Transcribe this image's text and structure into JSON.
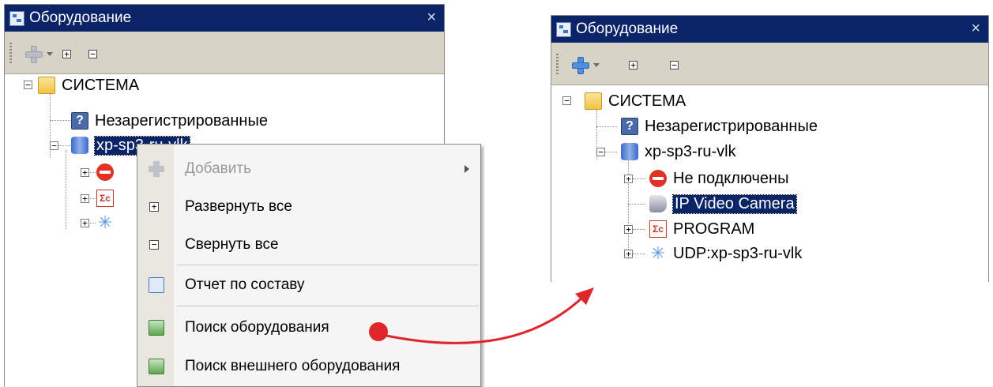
{
  "left_panel": {
    "title": "Оборудование",
    "close_glyph": "×",
    "toolbar": {
      "expand_glyph": "+",
      "collapse_glyph": "−"
    },
    "tree": [
      {
        "label": "СИСТЕМА",
        "icon": "folder-icon"
      },
      {
        "label": "Незарегистрированные",
        "icon": "question-icon"
      },
      {
        "label": "xp-sp3-ru-vlk",
        "icon": "database-icon",
        "selected": true
      }
    ]
  },
  "context_menu": {
    "items": [
      {
        "label": "Добавить",
        "icon": "plus-icon",
        "disabled": true,
        "submenu": true
      },
      {
        "label": "Развернуть все",
        "icon": "expand-box-icon"
      },
      {
        "label": "Свернуть все",
        "icon": "collapse-box-icon"
      },
      {
        "label": "Отчет по составу",
        "icon": "report-icon"
      },
      {
        "label": "Поиск оборудования",
        "icon": "search-hardware-icon"
      },
      {
        "label": "Поиск внешнего оборудования",
        "icon": "search-external-icon"
      }
    ]
  },
  "right_panel": {
    "title": "Оборудование",
    "close_glyph": "×",
    "tree": [
      {
        "label": "СИСТЕМА",
        "icon": "folder-icon"
      },
      {
        "label": "Незарегистрированные",
        "icon": "question-icon"
      },
      {
        "label": "xp-sp3-ru-vlk",
        "icon": "database-icon"
      },
      {
        "label": "Не подключены",
        "icon": "stop-icon"
      },
      {
        "label": "IP Video Camera",
        "icon": "camera-icon",
        "selected": true
      },
      {
        "label": "PROGRAM",
        "icon": "program-icon"
      },
      {
        "label": "UDP:xp-sp3-ru-vlk",
        "icon": "network-icon"
      }
    ]
  },
  "annotation": {
    "color": "#e0262a"
  }
}
